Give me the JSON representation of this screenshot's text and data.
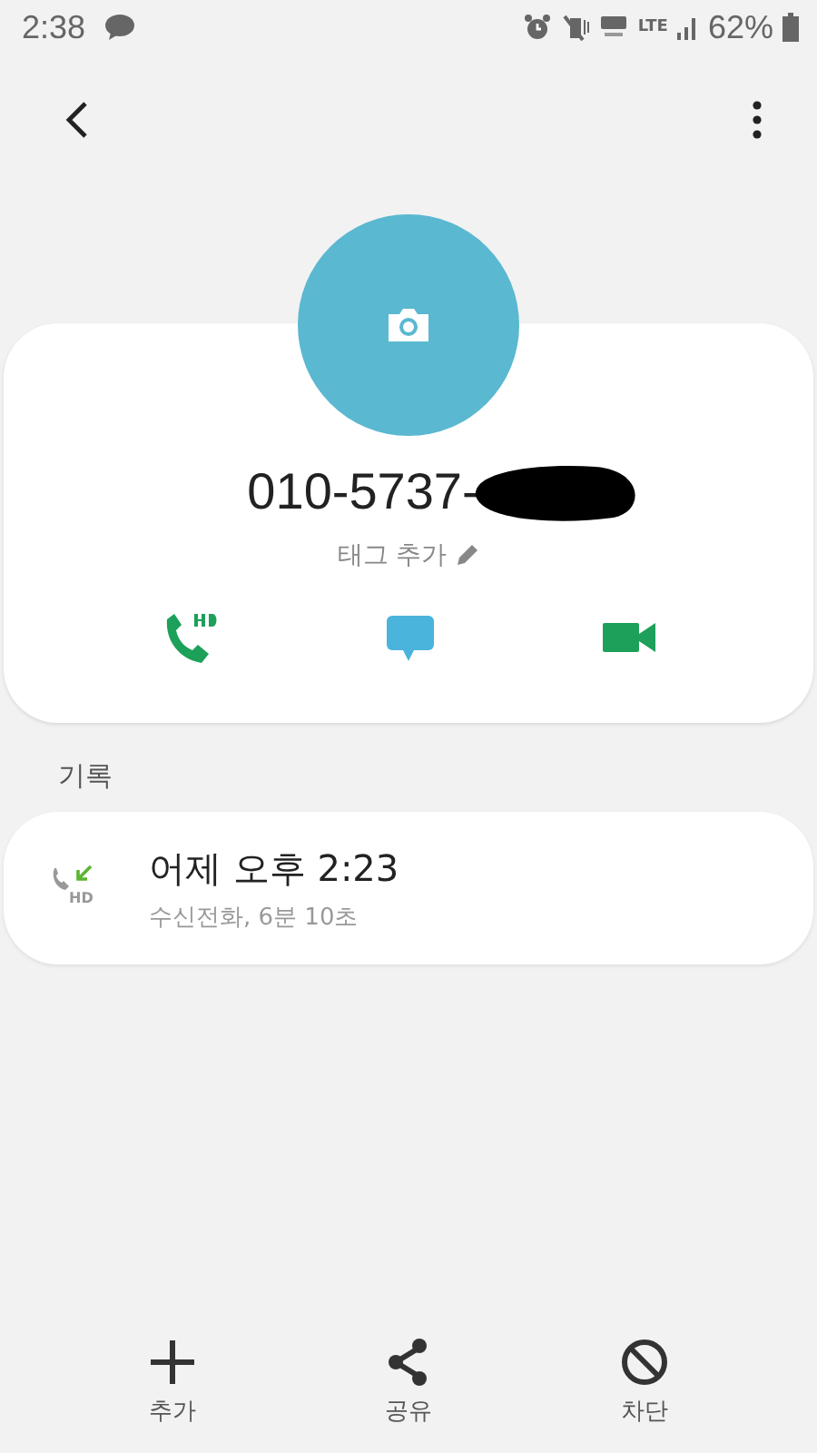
{
  "status_bar": {
    "time": "2:38",
    "network": "LTE",
    "battery": "62%"
  },
  "contact": {
    "number": "010-5737-",
    "number_redacted": true,
    "tag_label": "태그 추가"
  },
  "history": {
    "heading": "기록",
    "entries": [
      {
        "time": "어제 오후 2:23",
        "detail": "수신전화, 6분 10초",
        "badge": "HD"
      }
    ]
  },
  "bottom_bar": [
    {
      "kind": "add",
      "label": "추가"
    },
    {
      "kind": "share",
      "label": "공유"
    },
    {
      "kind": "block",
      "label": "차단"
    }
  ]
}
